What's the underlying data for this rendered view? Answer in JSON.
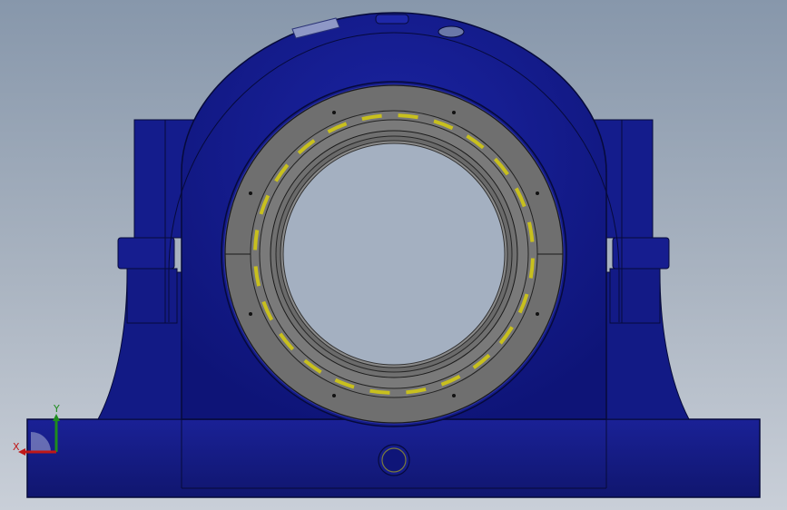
{
  "triad": {
    "y_label": "Y",
    "x_label": "X"
  },
  "colors": {
    "housing_blue": "#161d8c",
    "housing_dark": "#0b105a",
    "bearing_gray": "#6f6f6f",
    "roller_yellow": "#c8c01e",
    "background_top": "#8797ab",
    "background_bottom": "#c9cfd8"
  }
}
